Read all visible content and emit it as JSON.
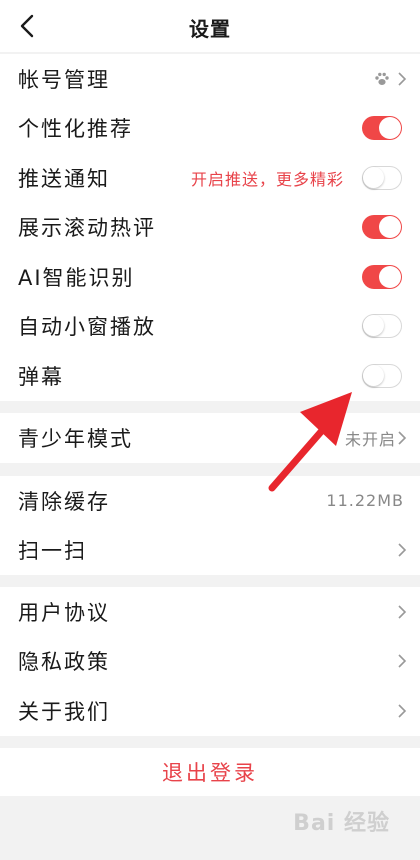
{
  "header": {
    "title": "设置"
  },
  "group1": [
    {
      "label": "帐号管理",
      "kind": "paw-chevron"
    },
    {
      "label": "个性化推荐",
      "kind": "toggle",
      "on": true
    },
    {
      "label": "推送通知",
      "kind": "toggle",
      "on": false,
      "hint": "开启推送，更多精彩"
    },
    {
      "label": "展示滚动热评",
      "kind": "toggle",
      "on": true
    },
    {
      "label": "AI智能识别",
      "kind": "toggle",
      "on": true
    },
    {
      "label": "自动小窗播放",
      "kind": "toggle",
      "on": false
    },
    {
      "label": "弹幕",
      "kind": "toggle",
      "on": false
    }
  ],
  "group2": [
    {
      "label": "青少年模式",
      "value": "未开启"
    }
  ],
  "group3": [
    {
      "label": "清除缓存",
      "value": "11.22MB"
    },
    {
      "label": "扫一扫"
    }
  ],
  "group4": [
    {
      "label": "用户协议"
    },
    {
      "label": "隐私政策"
    },
    {
      "label": "关于我们"
    }
  ],
  "logout_label": "退出登录",
  "watermark": "Bai 经验",
  "colors": {
    "accent": "#f04747",
    "text_red": "#e8434a",
    "arrow": "#e8262d"
  }
}
